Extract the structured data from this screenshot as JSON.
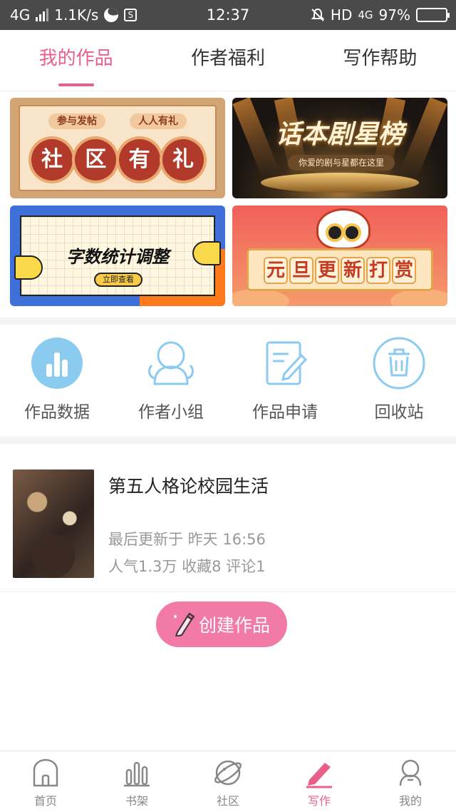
{
  "status_bar": {
    "network": "4G",
    "speed": "1.1K/s",
    "time": "12:37",
    "hd": "HD",
    "net_right": "4G",
    "battery": "97%",
    "battery_level": 0.97
  },
  "tabs": [
    {
      "label": "我的作品",
      "active": true
    },
    {
      "label": "作者福利",
      "active": false
    },
    {
      "label": "写作帮助",
      "active": false
    }
  ],
  "banners": {
    "community": {
      "tag_left": "参与发帖",
      "tag_right": "人人有礼",
      "chars": [
        "社",
        "区",
        "有",
        "礼"
      ]
    },
    "ranking": {
      "title": "话本剧星榜",
      "subtitle": "你爱的剧与星都在这里"
    },
    "wordcount": {
      "title": "字数统计调整",
      "button": "立即查看"
    },
    "newyear": {
      "chars": [
        "元",
        "旦",
        "更",
        "新",
        "打",
        "赏"
      ]
    }
  },
  "quick_menu": [
    {
      "label": "作品数据",
      "icon": "bar-chart-icon"
    },
    {
      "label": "作者小组",
      "icon": "group-avatar-icon"
    },
    {
      "label": "作品申请",
      "icon": "edit-document-icon"
    },
    {
      "label": "回收站",
      "icon": "trash-icon"
    }
  ],
  "work": {
    "title": "第五人格论校园生活",
    "updated": "最后更新于  昨天 16:56",
    "stats": "人气1.3万  收藏8  评论1"
  },
  "create_button": {
    "label": "创建作品"
  },
  "bottom_nav": [
    {
      "label": "首页",
      "icon": "home-icon",
      "active": false
    },
    {
      "label": "书架",
      "icon": "bookshelf-icon",
      "active": false
    },
    {
      "label": "社区",
      "icon": "planet-icon",
      "active": false
    },
    {
      "label": "写作",
      "icon": "pen-icon",
      "active": true
    },
    {
      "label": "我的",
      "icon": "profile-icon",
      "active": false
    }
  ],
  "colors": {
    "accent": "#e8608a",
    "button": "#f27aa6",
    "icon_blue": "#8ccbf0"
  }
}
